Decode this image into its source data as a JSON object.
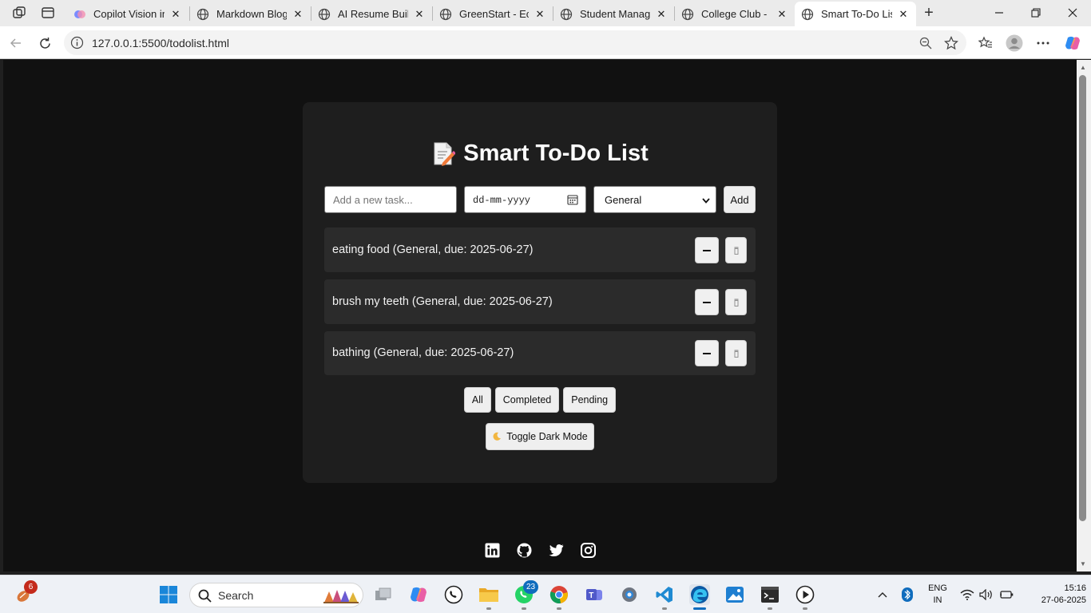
{
  "browser": {
    "tabs": [
      {
        "title": "Copilot Vision in",
        "favicon": "copilot-icon"
      },
      {
        "title": "Markdown Blog",
        "favicon": "globe-icon"
      },
      {
        "title": "AI Resume Builde",
        "favicon": "globe-icon"
      },
      {
        "title": "GreenStart - Eco",
        "favicon": "globe-icon"
      },
      {
        "title": "Student Manage",
        "favicon": "globe-icon"
      },
      {
        "title": "College Club - H",
        "favicon": "globe-icon"
      },
      {
        "title": "Smart To-Do List",
        "favicon": "globe-icon",
        "active": true
      }
    ],
    "url": "127.0.0.1:5500/todolist.html"
  },
  "app": {
    "title": "Smart To-Do List",
    "task_placeholder": "Add a new task...",
    "date_placeholder": "dd-mm-yyyy",
    "category_selected": "General",
    "add_label": "Add",
    "tasks": [
      {
        "label": "eating food (General, due: 2025-06-27)"
      },
      {
        "label": "brush my teeth (General, due: 2025-06-27)"
      },
      {
        "label": "bathing (General, due: 2025-06-27)"
      }
    ],
    "filters": {
      "all": "All",
      "completed": "Completed",
      "pending": "Pending"
    },
    "dark_mode_label": "Toggle Dark Mode"
  },
  "taskbar": {
    "search_label": "Search",
    "weather_badge": "6",
    "whatsapp_badge": "23",
    "lang_line1": "ENG",
    "lang_line2": "IN",
    "time": "15:16",
    "date": "27-06-2025"
  }
}
